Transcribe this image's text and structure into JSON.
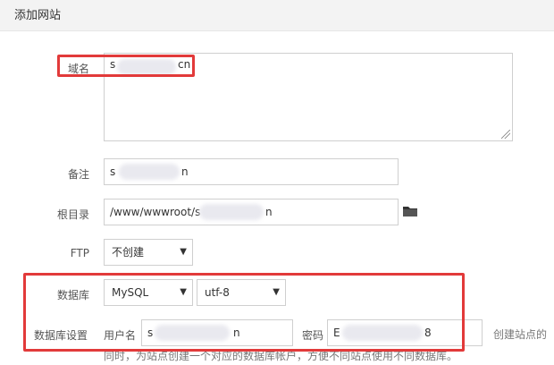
{
  "dialog": {
    "title": "添加网站"
  },
  "fields": {
    "domain": {
      "label": "域名",
      "value_start": "s",
      "value_end": "cn"
    },
    "remark": {
      "label": "备注",
      "value_start": "s",
      "value_end": "n"
    },
    "root": {
      "label": "根目录",
      "value_start": "/www/wwwroot/s",
      "value_end": "n",
      "folder_icon": "folder-icon"
    },
    "ftp": {
      "label": "FTP",
      "selected": "不创建"
    },
    "database": {
      "label": "数据库",
      "type_selected": "MySQL",
      "charset_selected": "utf-8"
    },
    "db_settings": {
      "label": "数据库设置",
      "user_label": "用户名",
      "user_value_start": "s",
      "user_value_end": "n",
      "password_label": "密码",
      "password_value_start": "E",
      "password_value_end": "8",
      "hint_right": "创建站点的",
      "hint_bottom": "同时，为站点创建一个对应的数据库帐户，方便不同站点使用不同数据库。"
    }
  },
  "colors": {
    "highlight": "#e23a3a",
    "border": "#cfcfcf"
  }
}
